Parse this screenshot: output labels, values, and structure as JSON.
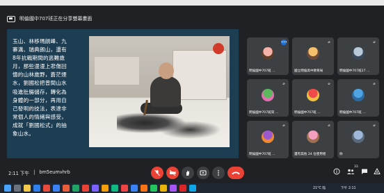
{
  "meeting": {
    "presenter_banner": "明倫國中707班正在分享螢幕畫面",
    "time": "2:11 下午",
    "meeting_code": "bm5eumvhrb",
    "participant_count": "33"
  },
  "slide": {
    "text": "玉山、林移瑪朗峰、九\n寨溝、瑞典朗山，還有\n8年抗戰期間的逃難歲\n月，那些漫漫上悲傷回\n憶的山林歲野，蒼茫煙\n水，劉國松把曾間山水\n吸進肚腸儲存，轉化為\n身體的一部分，再用自\n己發明的技法，表達非\n常個人的情緒與感受，\n成就「劉國松式」的抽\n象山水。"
  },
  "participants": [
    {
      "label": "明倫國中707班 ...",
      "speaking": true,
      "avatar_colors": [
        "#f4b2a8",
        "#5a3d2a"
      ]
    },
    {
      "label": "國立明倫高中教育局",
      "speaking": false,
      "avatar_colors": [
        "#f5c06b",
        "#6a4b3a"
      ]
    },
    {
      "label": "明倫國中707班27 ...",
      "speaking": false,
      "avatar_colors": [
        "#b8c9d9",
        "#3a4a5a"
      ]
    },
    {
      "label": "明倫國中707班同 ...",
      "speaking": false,
      "avatar_colors": [
        "#5cb85c",
        "#e26fb0"
      ]
    },
    {
      "label": "明倫國中707班 ...",
      "speaking": false,
      "avatar_colors": [
        "#ef4b4b",
        "#f0c040"
      ]
    },
    {
      "label": "明倫國中707班 ...",
      "speaking": false,
      "avatar_colors": [
        "#4fa3e0",
        "#2e6aa0"
      ]
    },
    {
      "label": "明倫國中707班 ...",
      "speaking": false,
      "avatar_colors": [
        "#9b59d0",
        "#f08a30"
      ]
    },
    {
      "label": "還有其他 24 位使用者",
      "speaking": false,
      "avatar_colors": [
        "#f3a0c0",
        "#a07050"
      ]
    },
    {
      "label": "你",
      "speaking": false,
      "avatar_colors": [
        "#9fb8d8",
        "#5a6a7a"
      ]
    }
  ],
  "controls": {
    "mic_icon": "mic-off-icon",
    "cam_icon": "camera-off-icon",
    "hand_icon": "raise-hand-icon",
    "present_icon": "present-screen-icon",
    "more_icon": "more-vertical-icon",
    "end_icon": "end-call-icon",
    "info_icon": "info-icon",
    "people_icon": "people-icon",
    "chat_icon": "chat-icon",
    "activities_icon": "activities-icon"
  },
  "taskbar": {
    "weather": "21°C 陰",
    "tray_time": "下午 2:11"
  },
  "colors": {
    "background": "#202124",
    "tile": "#3c4043",
    "accent": "#1a73e8",
    "danger": "#ea4335",
    "slide_bg": "#1c3d52"
  }
}
